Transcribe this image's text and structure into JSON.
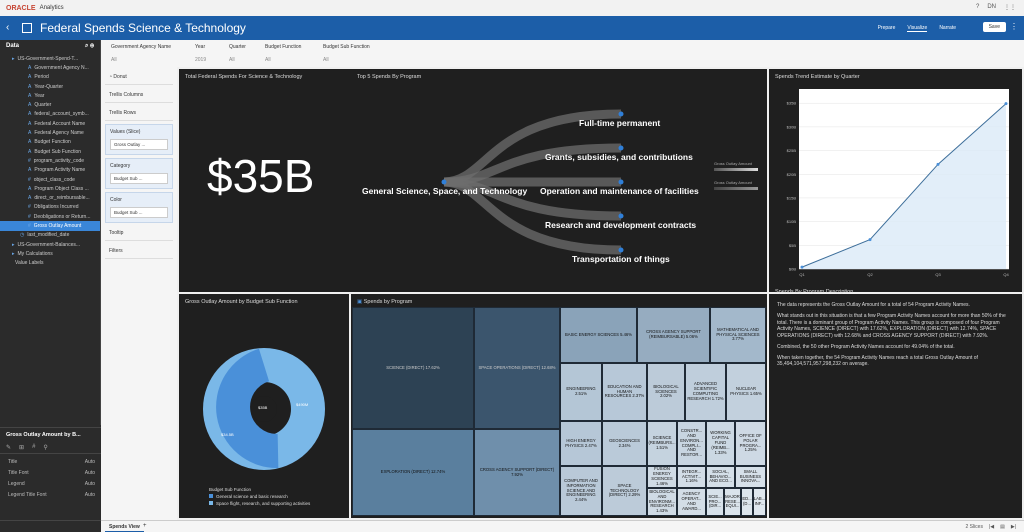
{
  "app": {
    "vendor": "ORACLE",
    "product": "Analytics",
    "project_title": "Federal Spends Science & Technology"
  },
  "topbar": {
    "help": "?",
    "user": "DN",
    "grid": "⋮⋮"
  },
  "modes": {
    "prepare": "Prepare",
    "visualize": "Visualize",
    "narrate": "Narrate",
    "save": "Save"
  },
  "data_panel": {
    "title": "Data",
    "items": [
      {
        "label": "US-Government-Spend-T...",
        "level": 0,
        "icon": "▸"
      },
      {
        "label": "Government Agency N...",
        "level": 2,
        "icon": "A"
      },
      {
        "label": "Period",
        "level": 2,
        "icon": "A"
      },
      {
        "label": "Year-Quarter",
        "level": 2,
        "icon": "A"
      },
      {
        "label": "Year",
        "level": 2,
        "icon": "A"
      },
      {
        "label": "Quarter",
        "level": 2,
        "icon": "A"
      },
      {
        "label": "federal_account_symb...",
        "level": 2,
        "icon": "A"
      },
      {
        "label": "Federal Account Name",
        "level": 2,
        "icon": "A"
      },
      {
        "label": "Federal Agency Name",
        "level": 2,
        "icon": "A"
      },
      {
        "label": "Budget Function",
        "level": 2,
        "icon": "A"
      },
      {
        "label": "Budget Sub Function",
        "level": 2,
        "icon": "A"
      },
      {
        "label": "program_activity_code",
        "level": 2,
        "icon": "#"
      },
      {
        "label": "Program Activity Name",
        "level": 2,
        "icon": "A"
      },
      {
        "label": "object_class_code",
        "level": 2,
        "icon": "#"
      },
      {
        "label": "Program Object Class ...",
        "level": 2,
        "icon": "A"
      },
      {
        "label": "direct_or_reimbursable...",
        "level": 2,
        "icon": "A"
      },
      {
        "label": "Obligations Incurred",
        "level": 2,
        "icon": "#"
      },
      {
        "label": "Deobligations or Return...",
        "level": 2,
        "icon": "#"
      },
      {
        "label": "Gross Outlay Amount",
        "level": 2,
        "icon": "#",
        "selected": true
      },
      {
        "label": "last_modified_date",
        "level": 1,
        "icon": "◷"
      },
      {
        "label": "US-Government-Balances...",
        "level": 0,
        "icon": "▸"
      },
      {
        "label": "My Calculations",
        "level": 0,
        "icon": "▸"
      },
      {
        "label": "Value Labels",
        "level": 0,
        "icon": ""
      }
    ]
  },
  "properties": {
    "title": "Gross Outlay Amount by B...",
    "rows": [
      {
        "label": "Title",
        "value": "Auto"
      },
      {
        "label": "Title Font",
        "value": "Auto"
      },
      {
        "label": "Legend",
        "value": "Auto"
      },
      {
        "label": "Legend Title Font",
        "value": "Auto"
      }
    ]
  },
  "grammar": {
    "viz_type": "Donut",
    "trellis_columns": "Trellis Columns",
    "trellis_rows": "Trellis Rows",
    "values_label": "Values (Slice)",
    "values_chip": "Gross Outlay ...",
    "category_label": "Category",
    "category_chip": "Budget Sub ...",
    "color_label": "Color",
    "color_chip": "Budget Sub ...",
    "tooltip": "Tooltip",
    "filters": "Filters"
  },
  "filters": [
    {
      "label": "Government Agency Name",
      "value": "All"
    },
    {
      "label": "Year",
      "value": "2019"
    },
    {
      "label": "Quarter",
      "value": "All"
    },
    {
      "label": "Budget Function",
      "value": "All"
    },
    {
      "label": "Budget Sub Function",
      "value": "All"
    }
  ],
  "tiles": {
    "kpi": {
      "title": "Total Federal Spends For Science & Technology",
      "value": "$35B"
    },
    "top5": {
      "title": "Top 5 Spends By Program",
      "root": "General Science, Space, and Technology",
      "leaves": [
        "Full-time permanent",
        "Grants, subsidies, and contributions",
        "Operation and maintenance of facilities",
        "Research and development contracts",
        "Transportation of things"
      ],
      "legend1": "Gross Outlay Amount",
      "legend2": "Gross Outlay Amount"
    },
    "trend": {
      "title": "Spends Trend Estimate by Quarter"
    },
    "donut": {
      "title": "Gross Outlay Amount by Budget Sub Function",
      "center": "$35B",
      "label_big": "$34.5B",
      "label_small": "$490M",
      "legend_title": "Budget Sub Function",
      "legend": [
        "General science and basic research",
        "Space flight, research, and supporting activities"
      ],
      "colors": [
        "#1f5f9e",
        "#7ab8e8"
      ]
    },
    "treemap": {
      "title": "Spends by Program",
      "cells": [
        "SCIENCE (DIRECT) 17.62%",
        "EXPLORATION (DIRECT) 12.74%",
        "SPACE OPERATIONS (DIRECT) 12.68%",
        "CROSS AGENCY SUPPORT (DIRECT) 7.92%",
        "BASIC ENERGY SCIENCES 5.46%",
        "CROSS AGENCY SUPPORT (REIMBURSABLE) 5.06%",
        "MATHEMATICAL AND PHYSICAL SCIENCES 3.77%",
        "ENGINEERING 2.51%",
        "EDUCATION AND HUMAN RESOURCES 2.37%",
        "BIOLOGICAL SCIENCES 2.02%",
        "ADVANCED SCIENTIFIC COMPUTING RESEARCH 1.72%",
        "NUCLEAR PHYSICS 1.65%",
        "SCIENCE (REIMBURS... 1.51%",
        "CONSTR... AND ENVIRON... COMPLI... AND RESTOR...",
        "WORKING CAPITAL FUND (REIMB... 1.33%",
        "OFFICE OF POLAR PROGRA... 1.25%",
        "HIGH ENERGY PHYSICS 2.47%",
        "GEOSCIENCES 2.34%",
        "FUSION ENERGY SCIENCES 1.46%",
        "INTEGR... ACTIVIT... 1.16%",
        "SOCIAL, BEHAVIO... AND ECO...",
        "SMALL BUSINESS INNOVA...",
        "COMPUTER AND INFORMATION SCIENCE AND ENGINEERING 2.44%",
        "SPACE TECHNOLOGY (DIRECT) 2.29%",
        "BIOLOGICAL AND ENVIRONM... RESEARCH 1.43%",
        "AGENCY OPERAT... AND AWARD...",
        "SCIE... PRO... (DIR...",
        "MAJOR RESE... EQUI...",
        "ED... (D...",
        "LAB... INF..."
      ]
    },
    "description": {
      "title": "Spends By Program Description",
      "p1": "The data represents the Gross Outlay Amount for a total of 54 Program Activity Names.",
      "p2": "What stands out in this situation is that a few Program Activity Names account for more than 50% of the total. There is a dominant group of Program Activity Names. This group is composed of four Program Activity Names, SCIENCE (DIRECT) with 17.62%, EXPLORATION (DIRECT) with 12.74%, SPACE OPERATIONS (DIRECT) with 12.68% and CROSS AGENCY SUPPORT (DIRECT) with 7.92%.",
      "p3": "Combined, the 50 other Program Activity Names account for 49.04% of the total.",
      "p4": "When taken together, the 54 Program Activity Names reach a total Gross Outlay Amount of 35,494,104,571,957,298,232 on average."
    }
  },
  "chart_data": {
    "type": "area",
    "categories": [
      "Q1",
      "Q2",
      "Q3",
      "Q4"
    ],
    "values": [
      0.4,
      6.2,
      22.1,
      34.9
    ],
    "yticks": [
      "$0B",
      "$5B",
      "$10B",
      "$15B",
      "$20B",
      "$25B",
      "$30B",
      "$35B"
    ],
    "ylim": [
      0,
      38
    ],
    "grid": true
  },
  "bottom": {
    "tab": "Spends View",
    "add": "+",
    "slices": "2 Slices"
  }
}
